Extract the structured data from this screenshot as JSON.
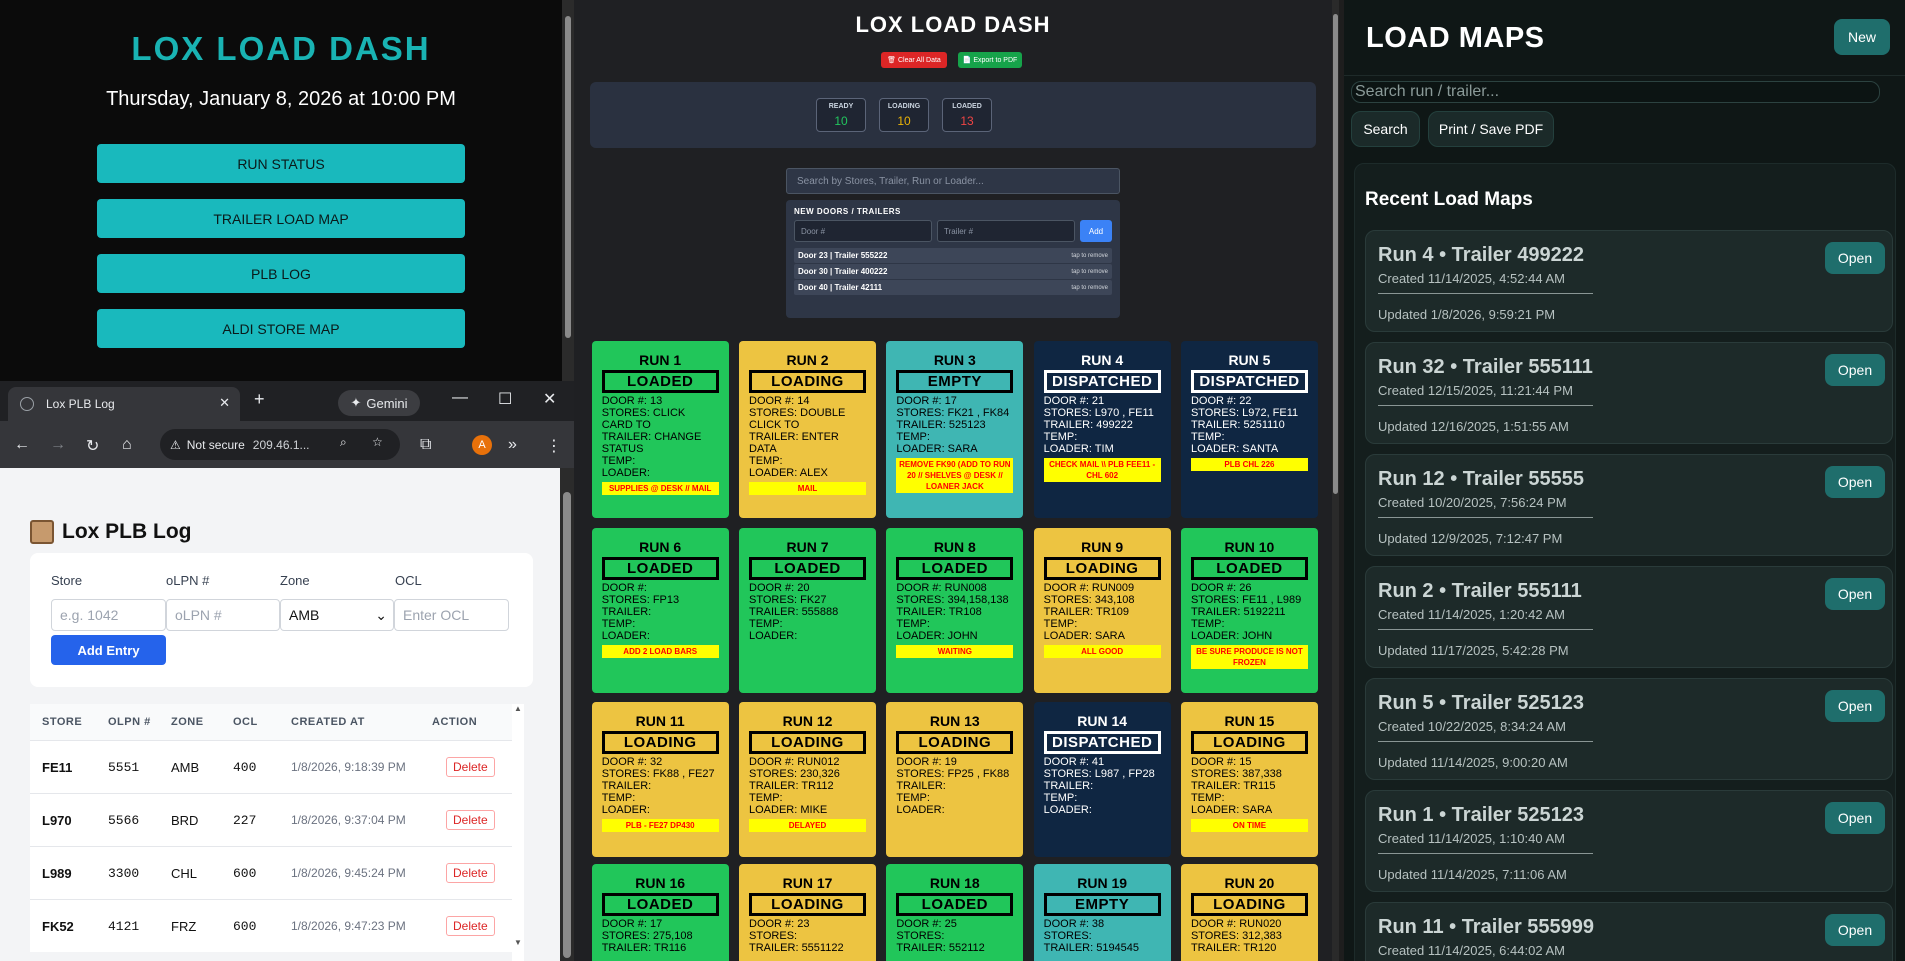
{
  "menu": {
    "title": "LOX LOAD DASH",
    "date": "Thursday, January 8, 2026 at 10:00 PM",
    "buttons": [
      "RUN STATUS",
      "TRAILER LOAD MAP",
      "PLB LOG",
      "ALDI STORE MAP"
    ]
  },
  "browser": {
    "tab_title": "Lox PLB Log",
    "gemini": "Gemini",
    "not_secure": "Not secure",
    "url": "209.46.1...",
    "avatar": "A"
  },
  "plb": {
    "heading": "Lox PLB Log",
    "labels": {
      "store": "Store",
      "olpn": "oLPN #",
      "zone": "Zone",
      "ocl": "OCL"
    },
    "placeholders": {
      "store": "e.g. 1042",
      "olpn": "oLPN #",
      "ocl": "Enter OCL"
    },
    "zone_value": "AMB",
    "add_entry": "Add Entry",
    "columns": [
      "STORE",
      "OLPN #",
      "ZONE",
      "OCL",
      "CREATED AT",
      "ACTION"
    ],
    "rows": [
      {
        "store": "FE11",
        "olpn": "5551",
        "zone": "AMB",
        "ocl": "400",
        "created": "1/8/2026, 9:18:39 PM",
        "action": "Delete"
      },
      {
        "store": "L970",
        "olpn": "5566",
        "zone": "BRD",
        "ocl": "227",
        "created": "1/8/2026, 9:37:04 PM",
        "action": "Delete"
      },
      {
        "store": "L989",
        "olpn": "3300",
        "zone": "CHL",
        "ocl": "600",
        "created": "1/8/2026, 9:45:24 PM",
        "action": "Delete"
      },
      {
        "store": "FK52",
        "olpn": "4121",
        "zone": "FRZ",
        "ocl": "600",
        "created": "1/8/2026, 9:47:23 PM",
        "action": "Delete"
      }
    ]
  },
  "board": {
    "title": "LOX LOAD DASH",
    "clear_btn": "🗑 Clear All Data",
    "export_btn": "📄 Export to PDF",
    "stats": [
      {
        "label": "READY",
        "value": "10",
        "color": "#22c55e"
      },
      {
        "label": "LOADING",
        "value": "10",
        "color": "#eab308"
      },
      {
        "label": "LOADED",
        "value": "13",
        "color": "#ef4444"
      }
    ],
    "search_placeholder": "Search by Stores, Trailer, Run or Loader...",
    "doors_title": "NEW DOORS / TRAILERS",
    "door_placeholder": "Door #",
    "trailer_placeholder": "Trailer #",
    "add_label": "Add",
    "doors": [
      {
        "text": "Door 23 | Trailer 555222",
        "remove": "tap to remove"
      },
      {
        "text": "Door 30 | Trailer 400222",
        "remove": "tap to remove"
      },
      {
        "text": "Door 40 | Trailer 42111",
        "remove": "tap to remove"
      }
    ],
    "runs": [
      {
        "title": "RUN 1",
        "status": "LOADED",
        "color": "green",
        "lines": [
          "DOOR #: 13",
          "STORES: CLICK CARD TO",
          "TRAILER: CHANGE STATUS",
          "TEMP:",
          "LOADER:"
        ],
        "note": "SUPPLIES @ DESK // MAIL"
      },
      {
        "title": "RUN 2",
        "status": "LOADING",
        "color": "yellow",
        "lines": [
          "DOOR #: 14",
          "STORES: DOUBLE CLICK TO",
          "TRAILER: ENTER DATA",
          "TEMP:",
          "LOADER: ALEX"
        ],
        "note": "MAIL"
      },
      {
        "title": "RUN 3",
        "status": "EMPTY",
        "color": "teal",
        "lines": [
          "DOOR #: 17",
          "STORES: FK21 , FK84",
          "TRAILER: 525123",
          "TEMP:",
          "LOADER: SARA"
        ],
        "note": "REMOVE FK90 (ADD TO RUN 20 // SHELVES @ DESK // LOANER JACK"
      },
      {
        "title": "RUN 4",
        "status": "DISPATCHED",
        "color": "dark",
        "lines": [
          "DOOR #: 21",
          "STORES: L970 , FE11",
          "TRAILER: 499222",
          "TEMP:",
          "LOADER: TIM"
        ],
        "note": "CHECK MAIL \\\\ PLB FEE11 -CHL 602"
      },
      {
        "title": "RUN 5",
        "status": "DISPATCHED",
        "color": "dark",
        "lines": [
          "DOOR #: 22",
          "STORES: L972, FE11",
          "TRAILER: 5251110",
          "TEMP:",
          "LOADER: SANTA"
        ],
        "note": "PLB CHL 226"
      },
      {
        "title": "RUN 6",
        "status": "LOADED",
        "color": "green",
        "lines": [
          "DOOR #:",
          "STORES: FP13",
          "TRAILER:",
          "TEMP:",
          "LOADER:"
        ],
        "note": "ADD 2 LOAD BARS"
      },
      {
        "title": "RUN 7",
        "status": "LOADED",
        "color": "green",
        "lines": [
          "DOOR #: 20",
          "STORES: FK27",
          "TRAILER: 555888",
          "TEMP:",
          "LOADER:"
        ],
        "note": ""
      },
      {
        "title": "RUN 8",
        "status": "LOADED",
        "color": "green",
        "lines": [
          "DOOR #: RUN008",
          "STORES: 394,158,138",
          "TRAILER: TR108",
          "TEMP:",
          "LOADER: JOHN"
        ],
        "note": "WAITING"
      },
      {
        "title": "RUN 9",
        "status": "LOADING",
        "color": "yellow",
        "lines": [
          "DOOR #: RUN009",
          "STORES: 343,108",
          "TRAILER: TR109",
          "TEMP:",
          "LOADER: SARA"
        ],
        "note": "ALL GOOD"
      },
      {
        "title": "RUN 10",
        "status": "LOADED",
        "color": "green",
        "lines": [
          "DOOR #: 26",
          "STORES: FE11 , L989",
          "TRAILER: 5192211",
          "TEMP:",
          "LOADER: JOHN"
        ],
        "note": "BE SURE PRODUCE IS NOT FROZEN"
      },
      {
        "title": "RUN 11",
        "status": "LOADING",
        "color": "yellow",
        "lines": [
          "DOOR #: 32",
          "STORES: FK88 , FE27",
          "TRAILER:",
          "TEMP:",
          "LOADER:"
        ],
        "note": "PLB - FE27 DP430"
      },
      {
        "title": "RUN 12",
        "status": "LOADING",
        "color": "yellow",
        "lines": [
          "DOOR #: RUN012",
          "STORES: 230,326",
          "TRAILER: TR112",
          "TEMP:",
          "LOADER: MIKE"
        ],
        "note": "DELAYED"
      },
      {
        "title": "RUN 13",
        "status": "LOADING",
        "color": "yellow",
        "lines": [
          "DOOR #: 19",
          "STORES: FP25 , FK88",
          "TRAILER:",
          "TEMP:",
          "LOADER:"
        ],
        "note": ""
      },
      {
        "title": "RUN 14",
        "status": "DISPATCHED",
        "color": "dark",
        "lines": [
          "DOOR #: 41",
          "STORES: L987 , FP28",
          "TRAILER:",
          "TEMP:",
          "LOADER:"
        ],
        "note": ""
      },
      {
        "title": "RUN 15",
        "status": "LOADING",
        "color": "yellow",
        "lines": [
          "DOOR #: 15",
          "STORES: 387,338",
          "TRAILER: TR115",
          "TEMP:",
          "LOADER: SARA"
        ],
        "note": "ON TIME"
      },
      {
        "title": "RUN 16",
        "status": "LOADED",
        "color": "green",
        "lines": [
          "DOOR #: 17",
          "STORES: 275,108",
          "TRAILER: TR116"
        ],
        "note": ""
      },
      {
        "title": "RUN 17",
        "status": "LOADING",
        "color": "yellow",
        "lines": [
          "DOOR #: 23",
          "STORES:",
          "TRAILER: 5551122"
        ],
        "note": ""
      },
      {
        "title": "RUN 18",
        "status": "LOADED",
        "color": "green",
        "lines": [
          "DOOR #: 25",
          "STORES:",
          "TRAILER: 552112"
        ],
        "note": ""
      },
      {
        "title": "RUN 19",
        "status": "EMPTY",
        "color": "teal",
        "lines": [
          "DOOR #: 38",
          "STORES:",
          "TRAILER: 5194545"
        ],
        "note": ""
      },
      {
        "title": "RUN 20",
        "status": "LOADING",
        "color": "yellow",
        "lines": [
          "DOOR #: RUN020",
          "STORES: 312,383",
          "TRAILER: TR120"
        ],
        "note": ""
      }
    ]
  },
  "maps": {
    "title": "LOAD MAPS",
    "new_btn": "New",
    "search_placeholder": "Search run / trailer...",
    "search_btn": "Search",
    "print_btn": "Print / Save PDF",
    "recent_title": "Recent Load Maps",
    "open_label": "Open",
    "items": [
      {
        "title": "Run 4 • Trailer 499222",
        "created": "Created 11/14/2025, 4:52:44 AM",
        "updated": "Updated 1/8/2026, 9:59:21 PM"
      },
      {
        "title": "Run 32 • Trailer 555111",
        "created": "Created 12/15/2025, 11:21:44 PM",
        "updated": "Updated 12/16/2025, 1:51:55 AM"
      },
      {
        "title": "Run 12 • Trailer 55555",
        "created": "Created 10/20/2025, 7:56:24 PM",
        "updated": "Updated 12/9/2025, 7:12:47 PM"
      },
      {
        "title": "Run 2 • Trailer 555111",
        "created": "Created 11/14/2025, 1:20:42 AM",
        "updated": "Updated 11/17/2025, 5:42:28 PM"
      },
      {
        "title": "Run 5 • Trailer 525123",
        "created": "Created 10/22/2025, 8:34:24 AM",
        "updated": "Updated 11/14/2025, 9:00:20 AM"
      },
      {
        "title": "Run 1 • Trailer 525123",
        "created": "Created 11/14/2025, 1:10:40 AM",
        "updated": "Updated 11/14/2025, 7:11:06 AM"
      },
      {
        "title": "Run 11 • Trailer 555999",
        "created": "Created 11/14/2025, 6:44:02 AM",
        "updated": ""
      }
    ]
  }
}
